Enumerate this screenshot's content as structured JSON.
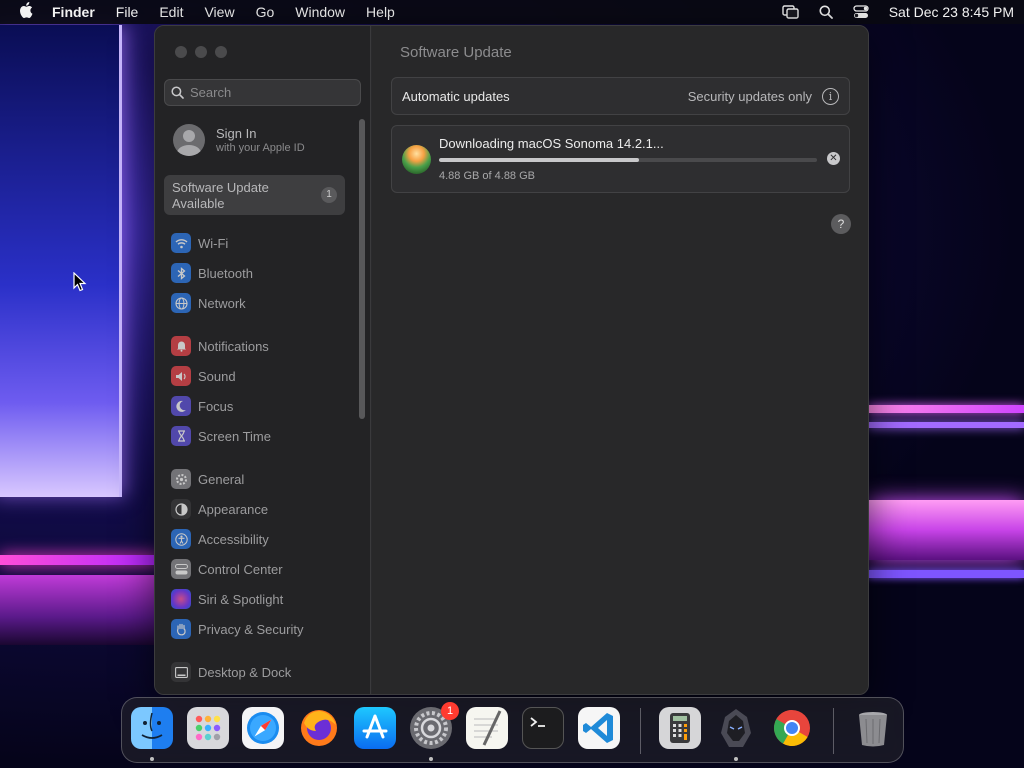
{
  "menubar": {
    "app_name": "Finder",
    "items": [
      "File",
      "Edit",
      "View",
      "Go",
      "Window",
      "Help"
    ],
    "clock": "Sat Dec 23  8:45 PM",
    "status_icons": [
      "screen-mirroring-icon",
      "spotlight-icon",
      "control-center-icon"
    ]
  },
  "window": {
    "search_placeholder": "Search",
    "profile": {
      "name": "Sign In",
      "subtitle": "with your Apple ID"
    },
    "update_card": {
      "line1": "Software Update",
      "line2": "Available",
      "badge": "1"
    },
    "nav_items": [
      {
        "label": "Wi-Fi",
        "icon": "wifi-icon",
        "color": "#2f7be6"
      },
      {
        "label": "Bluetooth",
        "icon": "bluetooth-icon",
        "color": "#2f7be6"
      },
      {
        "label": "Network",
        "icon": "globe-icon",
        "color": "#2f7be6"
      },
      {
        "label": "Notifications",
        "icon": "bell-icon",
        "color": "#e5484d"
      },
      {
        "label": "Sound",
        "icon": "speaker-icon",
        "color": "#e5484d"
      },
      {
        "label": "Focus",
        "icon": "moon-icon",
        "color": "#6155d8"
      },
      {
        "label": "Screen Time",
        "icon": "hourglass-icon",
        "color": "#6155d8"
      },
      {
        "label": "General",
        "icon": "gear-icon",
        "color": "#8e8e93"
      },
      {
        "label": "Appearance",
        "icon": "appearance-icon",
        "color": "#3a3a3c"
      },
      {
        "label": "Accessibility",
        "icon": "accessibility-icon",
        "color": "#2f7be6"
      },
      {
        "label": "Control Center",
        "icon": "control-center-icon",
        "color": "#8e8e93"
      },
      {
        "label": "Siri & Spotlight",
        "icon": "siri-icon",
        "color": "#b04ad8"
      },
      {
        "label": "Privacy & Security",
        "icon": "hand-icon",
        "color": "#2f7be6"
      },
      {
        "label": "Desktop & Dock",
        "icon": "desktop-icon",
        "color": "#3a3a3c"
      }
    ],
    "main": {
      "title": "Software Update",
      "automatic_updates": {
        "label": "Automatic updates",
        "value": "Security updates only"
      },
      "download": {
        "title": "Downloading macOS Sonoma 14.2.1...",
        "size_text": "4.88 GB of 4.88 GB",
        "progress_fraction": 0.53
      },
      "help_label": "?"
    }
  },
  "dock": {
    "apps": [
      {
        "name": "Finder",
        "icon": "finder-icon",
        "running": true
      },
      {
        "name": "Launchpad",
        "icon": "launchpad-icon",
        "running": false
      },
      {
        "name": "Safari",
        "icon": "safari-icon",
        "running": false
      },
      {
        "name": "Firefox",
        "icon": "firefox-icon",
        "running": false
      },
      {
        "name": "App Store",
        "icon": "app-store-icon",
        "running": false
      },
      {
        "name": "System Settings",
        "icon": "system-settings-icon",
        "running": true,
        "badge": "1"
      },
      {
        "name": "TextEdit",
        "icon": "textedit-icon",
        "running": false
      },
      {
        "name": "Terminal",
        "icon": "terminal-icon",
        "running": false
      },
      {
        "name": "Visual Studio Code",
        "icon": "vscode-icon",
        "running": false
      },
      {
        "name": "Calculator",
        "icon": "calculator-icon",
        "running": false
      },
      {
        "name": "Warrior",
        "icon": "warrior-icon",
        "running": true
      },
      {
        "name": "Chrome",
        "icon": "chrome-icon",
        "running": false
      },
      {
        "name": "Trash",
        "icon": "trash-icon",
        "running": false
      }
    ]
  }
}
